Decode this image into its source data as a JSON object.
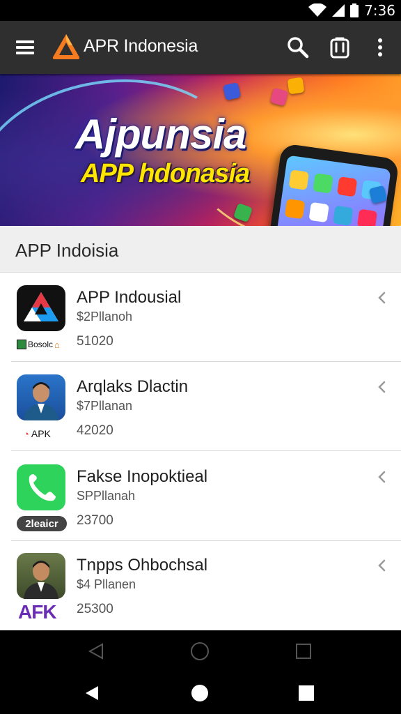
{
  "status": {
    "time": "7:36"
  },
  "appbar": {
    "title": "APR Indonesia"
  },
  "banner": {
    "line1": "Ajpunsia",
    "line2": "APP hdonasia"
  },
  "section": {
    "title": "APP Indoisia"
  },
  "apps": [
    {
      "title": "APP Indousial",
      "subtitle": "$2Pllanoh",
      "count": "51020",
      "badge": "Bosolc"
    },
    {
      "title": "Arqlaks Dlactin",
      "subtitle": "$7Pllanan",
      "count": "42020",
      "badge": "APK"
    },
    {
      "title": "Fakse Inopoktieal",
      "subtitle": "SPPllanah",
      "count": "23700",
      "badge": "2leaicr"
    },
    {
      "title": "Tnpps Ohbochsal",
      "subtitle": "$4 Pllanen",
      "count": "25300",
      "badge": "AFK"
    }
  ],
  "colors": {
    "appbar": "#2f2f2f",
    "logo": "#f47b20",
    "call_green": "#2ed35b",
    "afk_purple": "#6a2bb5"
  },
  "icons": [
    "wifi-icon",
    "cellular-icon",
    "battery-icon",
    "menu-icon",
    "search-icon",
    "share-icon",
    "more-vert-icon",
    "chevron-icon",
    "back-icon",
    "home-icon",
    "recents-icon"
  ]
}
